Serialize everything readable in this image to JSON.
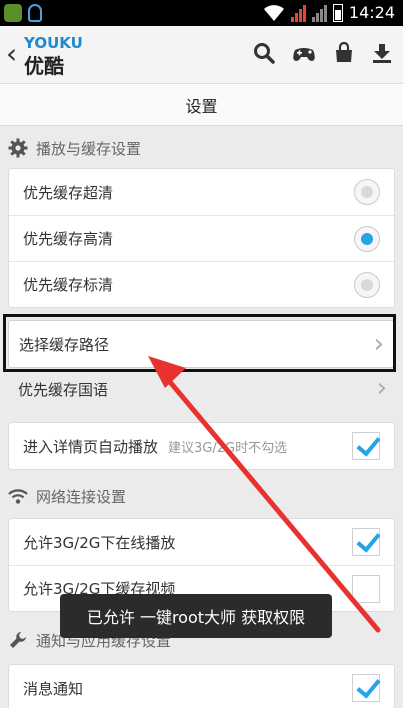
{
  "status_bar": {
    "time": "14:24"
  },
  "app_header": {
    "logo_text": "YOUKU",
    "logo_cn": "优酷",
    "back_glyph": "‹",
    "chevron_glyph": "›"
  },
  "page": {
    "title": "设置"
  },
  "sections": {
    "playback_cache": {
      "title": "播放与缓存设置",
      "options": [
        {
          "label": "优先缓存超清",
          "selected": false
        },
        {
          "label": "优先缓存高清",
          "selected": true
        },
        {
          "label": "优先缓存标清",
          "selected": false
        }
      ],
      "cache_path_label": "选择缓存路径",
      "language_label": "优先缓存国语",
      "autoplay_label": "进入详情页自动播放",
      "autoplay_hint": "建议3G/2G时不勾选",
      "autoplay_checked": true
    },
    "network": {
      "title": "网络连接设置",
      "online_play_label": "允许3G/2G下在线播放",
      "online_play_checked": true,
      "cache_video_label": "允许3G/2G下缓存视频",
      "cache_video_checked": false
    },
    "notifications": {
      "title": "通知与应用缓存设置",
      "message_label": "消息通知",
      "message_checked": true
    }
  },
  "toast": {
    "text": "已允许 一键root大师 获取权限"
  },
  "icons": {
    "header": [
      "search-icon",
      "gamepad-icon",
      "bag-icon",
      "download-icon"
    ],
    "sections": [
      "gear-icon",
      "wifi-icon",
      "wrench-icon"
    ]
  },
  "colors": {
    "accent": "#27a4e8",
    "annotation_arrow": "#e8322f",
    "logo_blue": "#1a8ad1",
    "logo_red": "#d4262a"
  }
}
